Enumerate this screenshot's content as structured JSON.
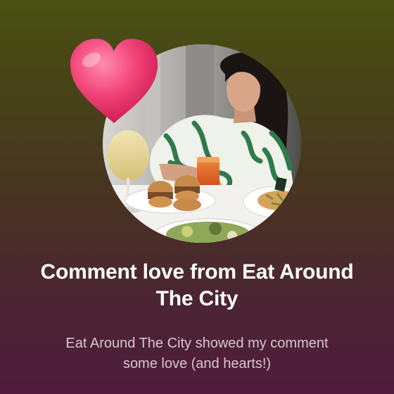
{
  "notification": {
    "title": "Comment love from Eat Around The City",
    "description": "Eat Around The City showed my comment some love (and hearts!)"
  },
  "icons": {
    "badge": "heart-icon"
  },
  "colors": {
    "background_top": "#485111",
    "background_bottom": "#4f1c3d",
    "heart": "#f0326e",
    "title_text": "#ffffff",
    "subtitle_text": "#d8c6cc"
  }
}
